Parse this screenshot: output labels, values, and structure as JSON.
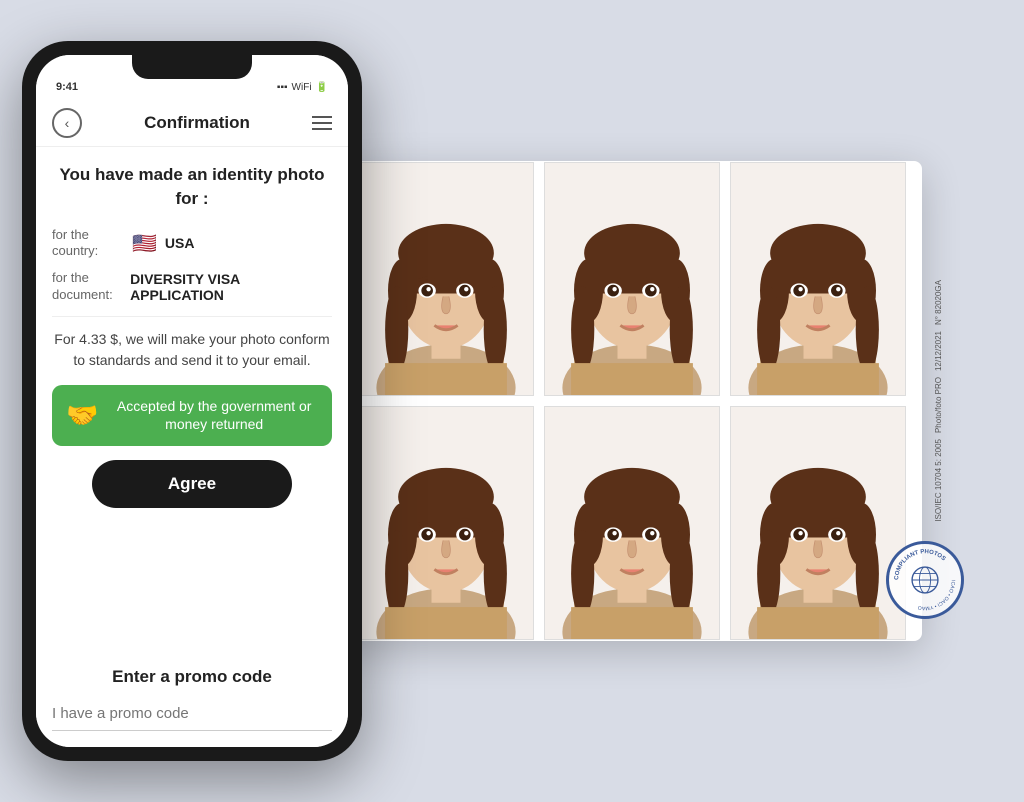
{
  "phone": {
    "nav": {
      "back_label": "‹",
      "title": "Confirmation",
      "menu_icon": "menu-icon"
    },
    "header": {
      "title": "You have made an identity photo for :"
    },
    "country_label": "for the country:",
    "country_value": "USA",
    "country_flag": "🇺🇸",
    "document_label": "for the document:",
    "document_value": "DIVERSITY VISA APPLICATION",
    "price_text": "For 4.33 $, we will make your photo conform to standards and send it to your email.",
    "guarantee": {
      "icon": "🤝",
      "text": "Accepted by the government or money returned"
    },
    "agree_button": "Agree",
    "promo": {
      "title": "Enter a promo code",
      "placeholder": "I have a promo code"
    }
  },
  "photo_sheet": {
    "sidebar": {
      "line1": "N° 82020GA",
      "line2": "12/12/2021",
      "line3": "Photo/foto PRO",
      "line4": "ISO/IEC 10704 5: 2005"
    },
    "stamp": {
      "outer_text": "COMPLIANT PHOTOS",
      "inner_text": "ICAO OACI YMAO"
    }
  },
  "colors": {
    "green": "#4caf50",
    "dark": "#1a1a1a",
    "blue_stamp": "#3a5a9a"
  }
}
